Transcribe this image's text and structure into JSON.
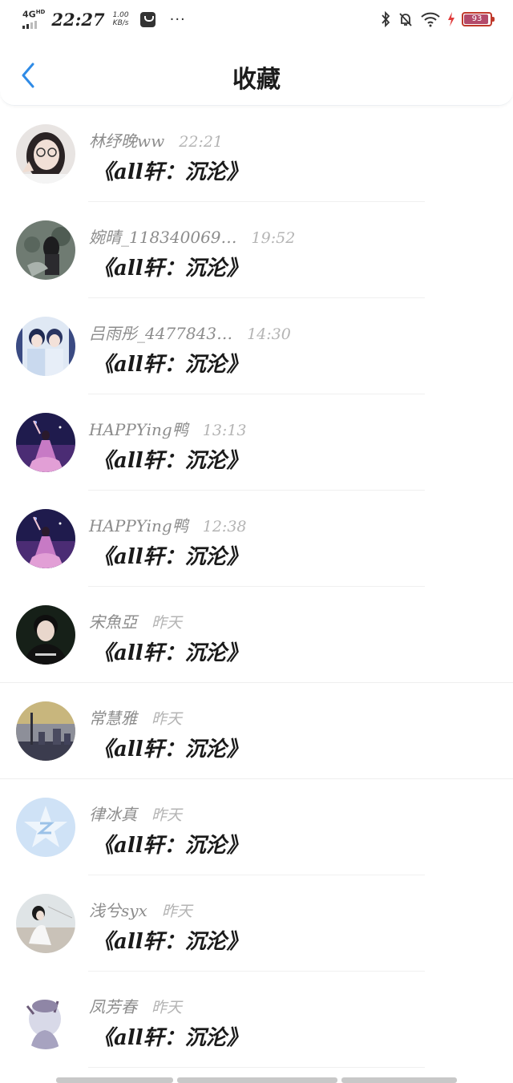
{
  "status_bar": {
    "network": "4G",
    "network_sup": "HD",
    "time": "22:27",
    "speed_value": "1.00",
    "speed_unit": "KB/s",
    "more": "···",
    "battery_level": "93",
    "battery_fraction": 0.93
  },
  "header": {
    "title": "收藏",
    "back_icon": "chevron-left-icon",
    "accent_color": "#2f8be6"
  },
  "favorites": [
    {
      "name": "林纾晚ww",
      "time": "22:21",
      "content": "《all轩：沉沦》",
      "avatar": "girl-glasses"
    },
    {
      "name": "婉晴_118340069…",
      "time": "19:52",
      "content": "《all轩：沉沦》",
      "avatar": "girl-dark"
    },
    {
      "name": "吕雨彤_4477843…",
      "time": "14:30",
      "content": "《all轩：沉沦》",
      "avatar": "two-boys"
    },
    {
      "name": "HAPPYing鸭",
      "time": "13:13",
      "content": "《all轩：沉沦》",
      "avatar": "purple-dress"
    },
    {
      "name": "HAPPYing鸭",
      "time": "12:38",
      "content": "《all轩：沉沦》",
      "avatar": "purple-dress"
    },
    {
      "name": "宋魚亞",
      "time": "昨天",
      "content": "《all轩：沉沦》",
      "avatar": "boy-black"
    },
    {
      "name": "常慧雅",
      "time": "昨天",
      "content": "《all轩：沉沦》",
      "avatar": "city-sunset"
    },
    {
      "name": "律冰真",
      "time": "昨天",
      "content": "《all轩：沉沦》",
      "avatar": "default-z"
    },
    {
      "name": "浅兮syx",
      "time": "昨天",
      "content": "《all轩：沉沦》",
      "avatar": "girl-beach"
    },
    {
      "name": "凤芳春",
      "time": "昨天",
      "content": "《all轩：沉沦》",
      "avatar": "anime-girl"
    }
  ]
}
